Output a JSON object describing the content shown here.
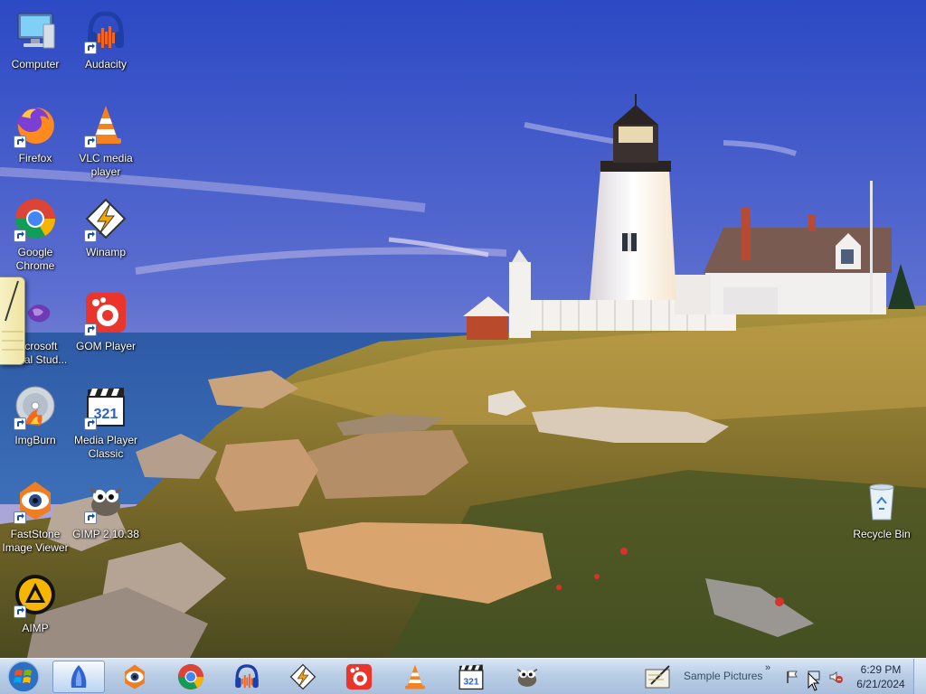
{
  "desktop": {
    "icons_col1": [
      {
        "label": "Computer",
        "icon": "computer-icon"
      },
      {
        "label": "Firefox",
        "icon": "firefox-icon"
      },
      {
        "label": "Google Chrome",
        "icon": "chrome-icon"
      },
      {
        "label": "Microsoft Visual Stud...",
        "icon": "visual-studio-icon"
      },
      {
        "label": "ImgBurn",
        "icon": "imgburn-icon"
      },
      {
        "label": "FastStone Image Viewer",
        "icon": "faststone-icon"
      },
      {
        "label": "AIMP",
        "icon": "aimp-icon"
      }
    ],
    "icons_col2": [
      {
        "label": "Audacity",
        "icon": "audacity-icon"
      },
      {
        "label": "VLC media player",
        "icon": "vlc-icon"
      },
      {
        "label": "Winamp",
        "icon": "winamp-icon"
      },
      {
        "label": "GOM Player",
        "icon": "gom-player-icon"
      },
      {
        "label": "Media Player Classic",
        "icon": "mpc-icon"
      },
      {
        "label": "GIMP 2.10.38",
        "icon": "gimp-icon"
      }
    ],
    "recycle_bin": {
      "label": "Recycle Bin",
      "icon": "recycle-bin-icon"
    }
  },
  "taskbar": {
    "start": {
      "icon": "windows-start-icon"
    },
    "buttons": [
      {
        "icon": "app-blue-icon",
        "active": true
      },
      {
        "icon": "faststone-icon"
      },
      {
        "icon": "chrome-icon"
      },
      {
        "icon": "audacity-icon"
      },
      {
        "icon": "winamp-icon"
      },
      {
        "icon": "gom-player-icon"
      },
      {
        "icon": "vlc-icon"
      },
      {
        "icon": "mpc-icon"
      },
      {
        "icon": "gimp-icon"
      }
    ],
    "toolbar_label": "Sample Pictures",
    "toolbar_chevron": "»",
    "clock_time": "6:29 PM",
    "clock_date": "6/21/2024"
  },
  "colors": {
    "sky_top": "#3a55c8",
    "sky_bottom": "#a9a9dc",
    "sea": "#2a5aa8",
    "grass": "#8a7a2e",
    "taskbar": "#b9cde5"
  }
}
